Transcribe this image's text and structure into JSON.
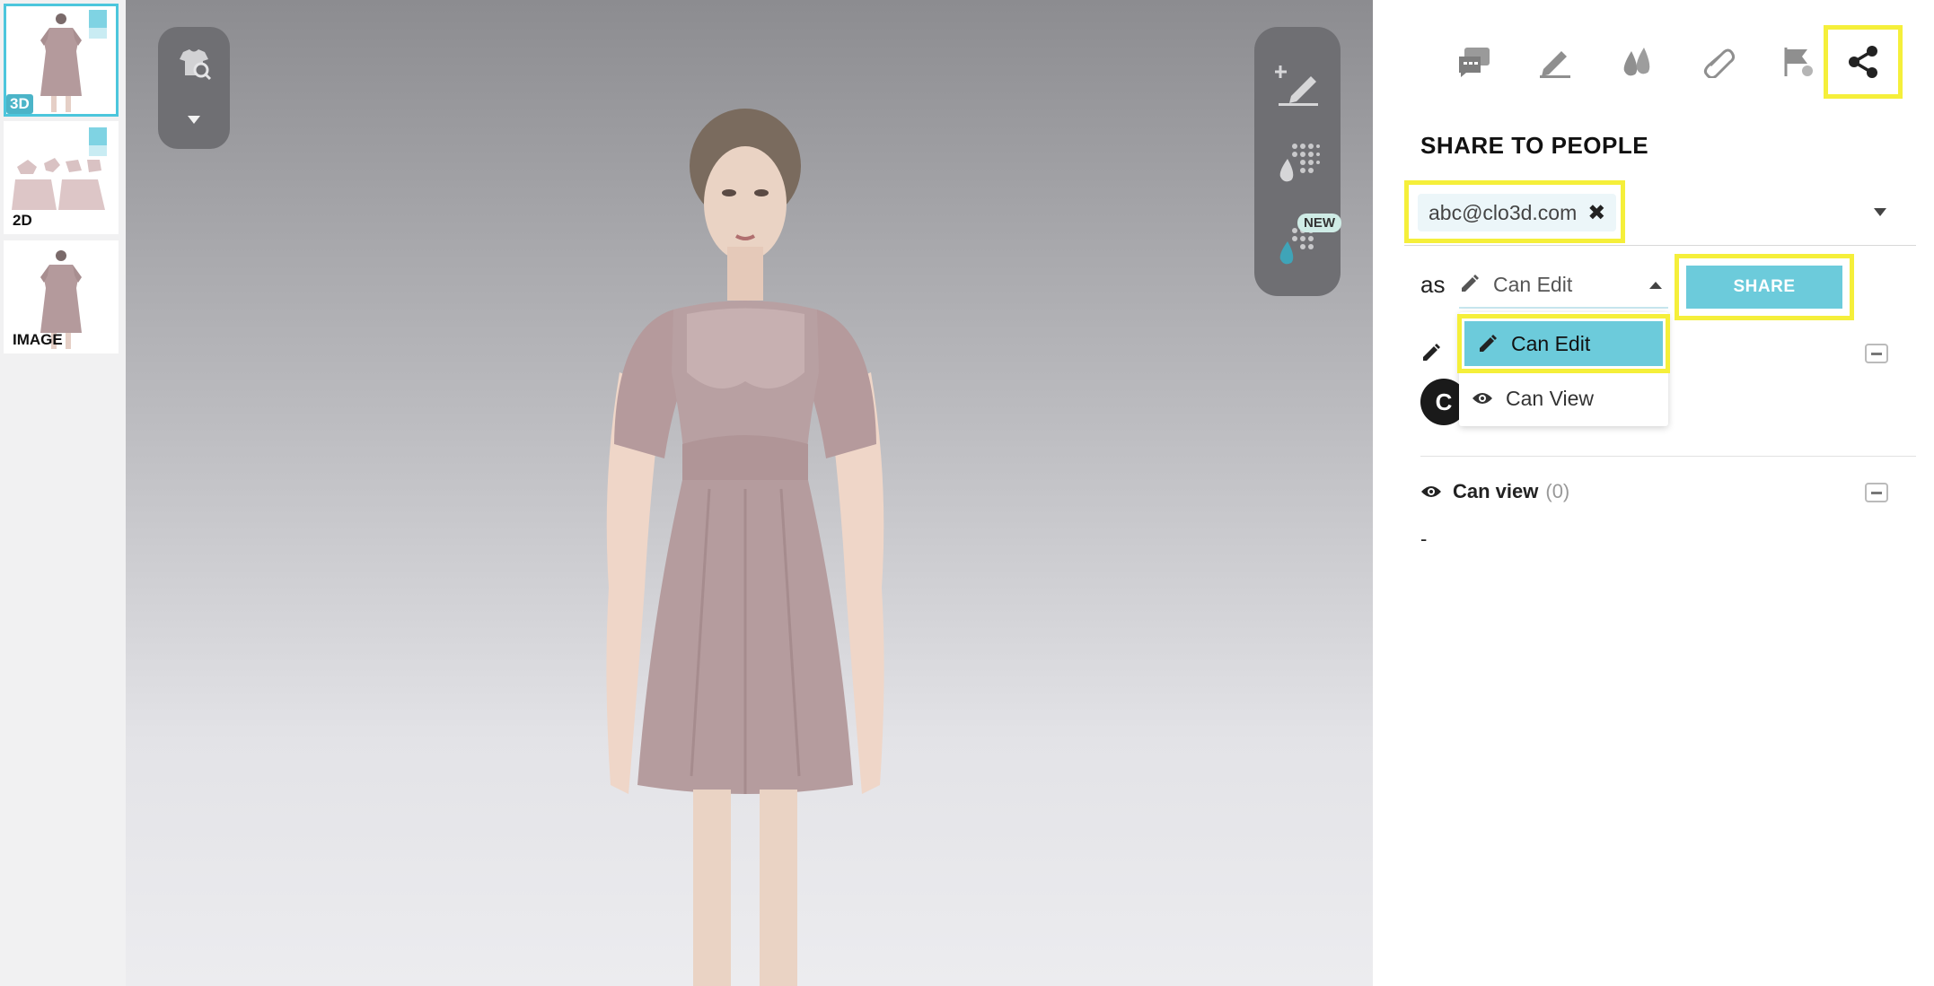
{
  "thumbnails": [
    {
      "label": "3D",
      "active": true
    },
    {
      "label": "2D",
      "active": false
    },
    {
      "label": "IMAGE",
      "active": false
    }
  ],
  "viewport": {
    "right_toolbar": {
      "new_badge": "NEW"
    }
  },
  "panel": {
    "tabs": [
      "comments-icon",
      "highlighter-icon",
      "colorway-icon",
      "attachment-icon",
      "flag-icon",
      "share-icon"
    ],
    "active_tab": "share-icon",
    "title": "SHARE TO PEOPLE",
    "recipient_chip": "abc@clo3d.com",
    "chip_remove": "✖",
    "as_label": "as",
    "role_selected": "Can Edit",
    "share_button": "SHARE",
    "role_options": [
      "Can Edit",
      "Can View"
    ],
    "can_edit_section": {
      "avatar_letter": "C"
    },
    "can_view_section": {
      "label": "Can view",
      "count": "(0)",
      "empty": "-"
    }
  },
  "colors": {
    "accent": "#6ccbdb",
    "highlight": "#f5ef3a",
    "toolbar": "#6f6f73"
  }
}
